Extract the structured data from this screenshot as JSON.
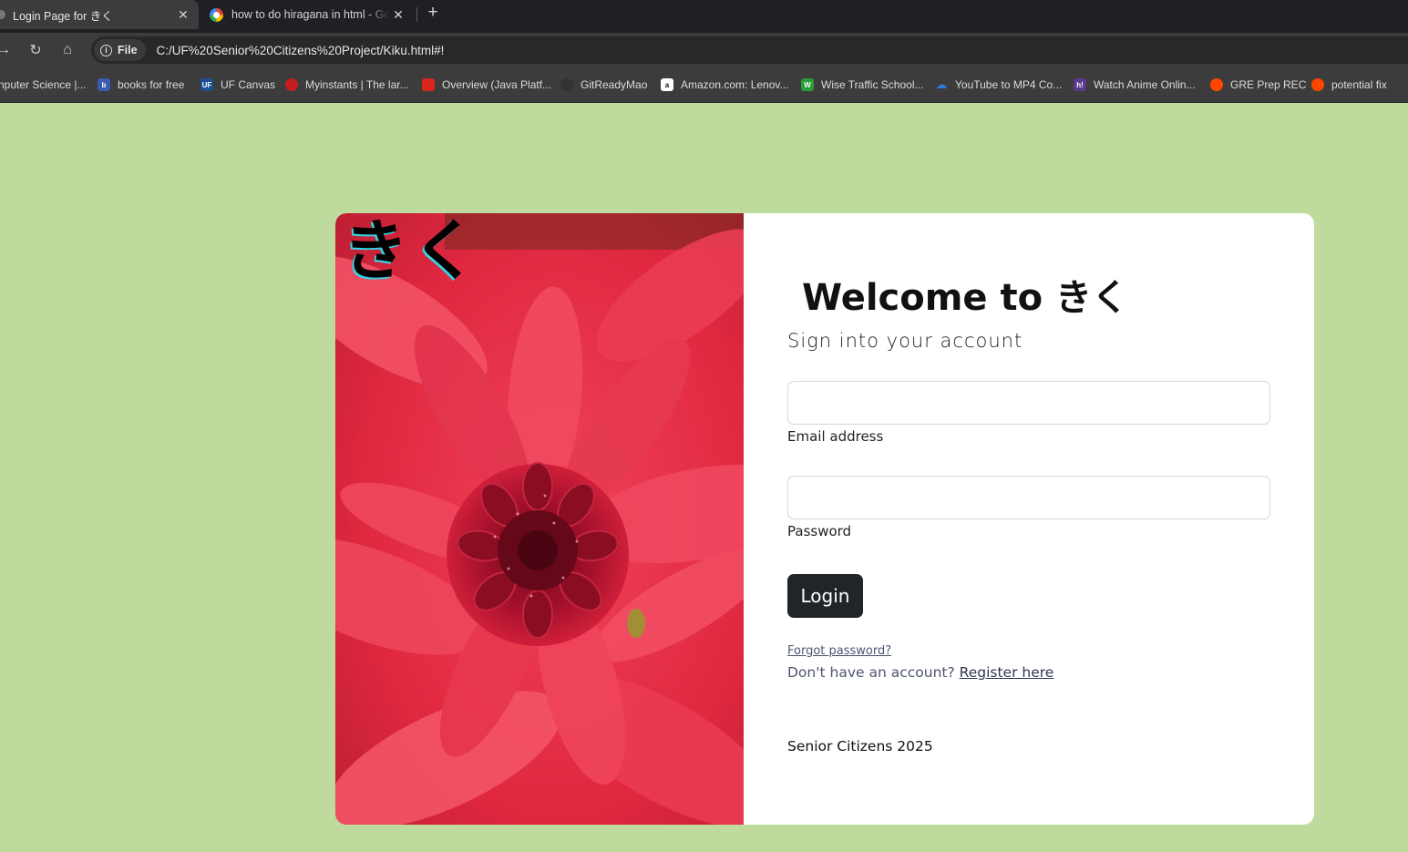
{
  "browser": {
    "tabs": [
      {
        "title": "Login Page for きく",
        "close": "✕"
      },
      {
        "title": "how to do hiragana in html - Google",
        "close": "✕"
      }
    ],
    "new_tab_glyph": "+",
    "nav": {
      "forward": "→",
      "reload": "↻",
      "home": "⌂"
    },
    "address": {
      "chip_label": "File",
      "info_glyph": "i",
      "url": "C:/UF%20Senior%20Citizens%20Project/Kiku.html#!"
    },
    "bookmarks": [
      {
        "label": "nputer Science |...",
        "icon": "bookmark-icon",
        "color": "#555555",
        "glyph": ""
      },
      {
        "label": "books for free",
        "icon": "book-icon",
        "color": "#3b5bb3",
        "glyph": "b"
      },
      {
        "label": "UF Canvas",
        "icon": "uf-icon",
        "color": "#1d4f91",
        "glyph": "UF"
      },
      {
        "label": "Myinstants | The lar...",
        "icon": "button-icon",
        "color": "#c41e1e",
        "glyph": "●"
      },
      {
        "label": "Overview (Java Platf...",
        "icon": "oracle-icon",
        "color": "#d8261c",
        "glyph": "▭"
      },
      {
        "label": "GitReadyMao",
        "icon": "github-icon",
        "color": "#333333",
        "glyph": "◉"
      },
      {
        "label": "Amazon.com: Lenov...",
        "icon": "amazon-icon",
        "color": "#ffffff",
        "glyph": "a"
      },
      {
        "label": "Wise Traffic School...",
        "icon": "wise-icon",
        "color": "#2a9d3a",
        "glyph": "W"
      },
      {
        "label": "YouTube to MP4 Co...",
        "icon": "cloud-download-icon",
        "color": "#2a7bd4",
        "glyph": "☁"
      },
      {
        "label": "Watch Anime Onlin...",
        "icon": "hianime-icon",
        "color": "#5b3b8c",
        "glyph": "h!"
      },
      {
        "label": "GRE Prep REC",
        "icon": "reddit-icon",
        "color": "#ff4500",
        "glyph": "●"
      },
      {
        "label": "potential fix",
        "icon": "reddit-icon",
        "color": "#ff4500",
        "glyph": "●"
      }
    ]
  },
  "page": {
    "brand_logo": "きく",
    "welcome": "Welcome to きく",
    "subtitle": "Sign into your account",
    "email_label": "Email address",
    "email_value": "",
    "password_label": "Password",
    "password_value": "",
    "login_label": "Login",
    "forgot_label": "Forgot password?",
    "no_account_text": "Don't have an account? ",
    "register_label": "Register here",
    "footer": "Senior Citizens 2025"
  },
  "colors": {
    "page_background": "#bfda9d",
    "login_button": "#212529",
    "flower_red": "#e8283c"
  }
}
